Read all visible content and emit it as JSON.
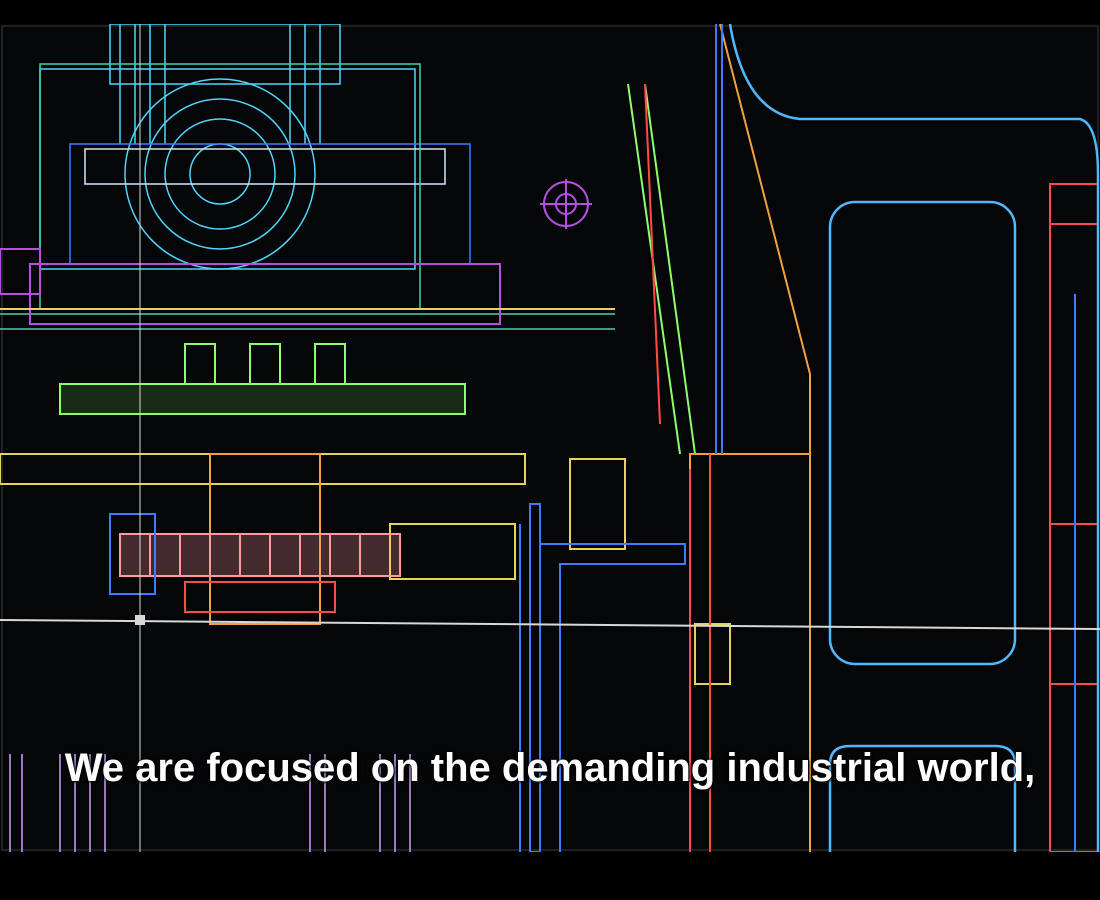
{
  "video": {
    "caption": "We are focused on the demanding industrial world,"
  },
  "scene": {
    "subject": "cad-mechanical-drawing",
    "line_colors": {
      "cyan": "#4fd6ff",
      "blue": "#3f7bff",
      "teal": "#3fd3b0",
      "green": "#8cff6a",
      "yellow": "#e8d35a",
      "orange": "#f0a040",
      "red": "#ff4a4a",
      "pink": "#ff9aa0",
      "magenta": "#b450e0",
      "white": "#d8d8d8"
    }
  }
}
